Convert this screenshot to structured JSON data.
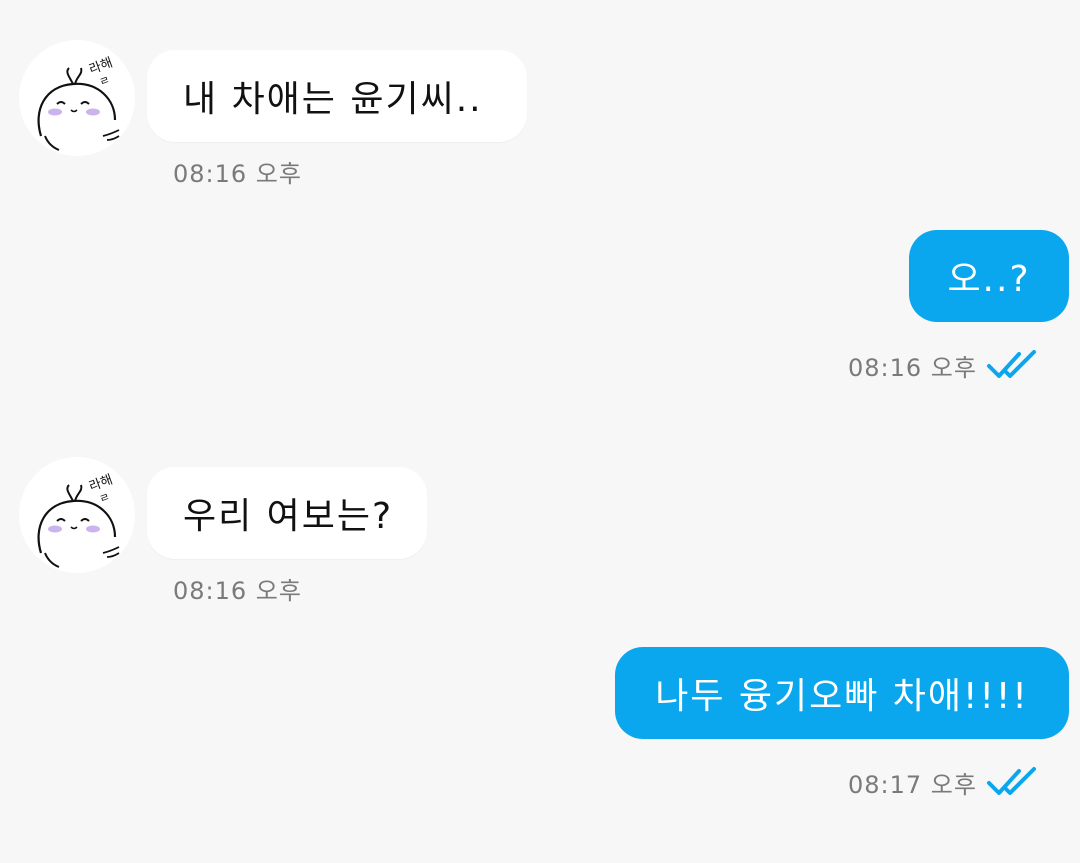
{
  "accent_color": "#0aa7ee",
  "messages": [
    {
      "direction": "incoming",
      "text": "내 차애는 윤기씨..",
      "time": "08:16 오후",
      "avatar_icon": "cartoon-character-avatar-icon"
    },
    {
      "direction": "outgoing",
      "text": "오..?",
      "time": "08:16 오후",
      "status_icon": "double-check-read-icon"
    },
    {
      "direction": "incoming",
      "text": "우리 여보는?",
      "time": "08:16 오후",
      "avatar_icon": "cartoon-character-avatar-icon"
    },
    {
      "direction": "outgoing",
      "text": "나두 융기오빠 차애!!!!",
      "time": "08:17 오후",
      "status_icon": "double-check-read-icon"
    }
  ]
}
